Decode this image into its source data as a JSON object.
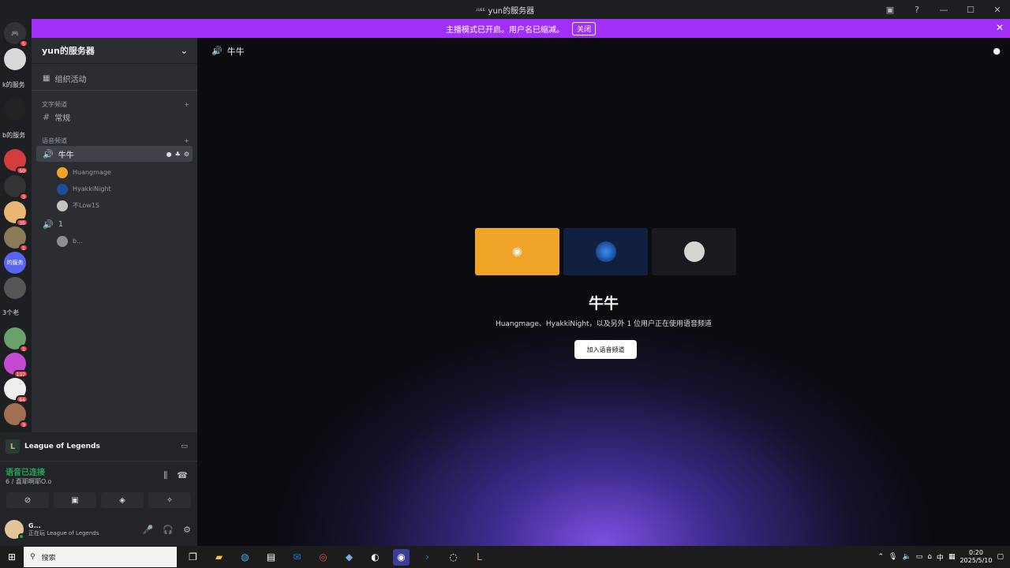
{
  "window": {
    "title": "yun的服务器",
    "title_prefix": "ᴊᴜᴇᴇ"
  },
  "banner": {
    "text": "主播模式已开启。用户名已缩减。",
    "button": "关闭"
  },
  "guilds": {
    "items": [
      {
        "name": "discord-home",
        "badge": "5",
        "color": "#5865f2"
      },
      {
        "name": "guild-1",
        "badge": "",
        "color": "#d9d9d9"
      },
      {
        "name": "guild-text-1",
        "text": "k的服务"
      },
      {
        "name": "guild-2",
        "badge": "",
        "color": "#222"
      },
      {
        "name": "guild-text-2",
        "text": "b的服务"
      },
      {
        "name": "guild-3",
        "badge": "50",
        "color": "#d13c3c"
      },
      {
        "name": "guild-4",
        "badge": "3",
        "color": "#333"
      },
      {
        "name": "guild-5",
        "badge": "35",
        "color": "#e8b774"
      },
      {
        "name": "guild-6",
        "badge": "1",
        "color": "#8a7a5a"
      },
      {
        "name": "guild-7",
        "badge": "",
        "color": "#5865f2",
        "text": "的服务"
      },
      {
        "name": "guild-8",
        "badge": "",
        "color": "#555"
      },
      {
        "name": "guild-text-3",
        "text": "3个老"
      },
      {
        "name": "guild-9",
        "badge": "1",
        "color": "#6aa06a"
      },
      {
        "name": "guild-10",
        "badge": "137",
        "color": "#c54ad0"
      },
      {
        "name": "guild-11",
        "badge": "64",
        "color": "#eee"
      },
      {
        "name": "guild-12",
        "badge": "3",
        "color": "#a07050"
      }
    ]
  },
  "sidebar": {
    "server_name": "yun的服务器",
    "events_label": "组织活动",
    "text_category": "文字频道",
    "text_channel": "常规",
    "voice_category": "语音频道",
    "voice_channel_active": "牛牛",
    "members_active": [
      "Huangmage",
      "HyakkiNight",
      "不Low1S"
    ],
    "voice_channel_2": "1",
    "members_2": [
      "b..."
    ]
  },
  "panel": {
    "game_name": "League of Legends",
    "voice_status": "语音已连接",
    "voice_detail": "6 / 喜耶啊耶O.o",
    "user_name": "G...",
    "user_status": "正在玩 League of Legends"
  },
  "main": {
    "header_channel": "牛牛",
    "channel_name": "牛牛",
    "subtitle": "Huangmage、HyakkiNight，以及另外 1 位用户正在使用语音频道",
    "join_button": "加入语音频道",
    "tile_colors": [
      "#f0a428",
      "#12203f",
      "#1a1a1e"
    ]
  },
  "taskbar": {
    "search_placeholder": "搜索",
    "ime": "中",
    "time": "0:20",
    "date": "2025/5/10"
  }
}
